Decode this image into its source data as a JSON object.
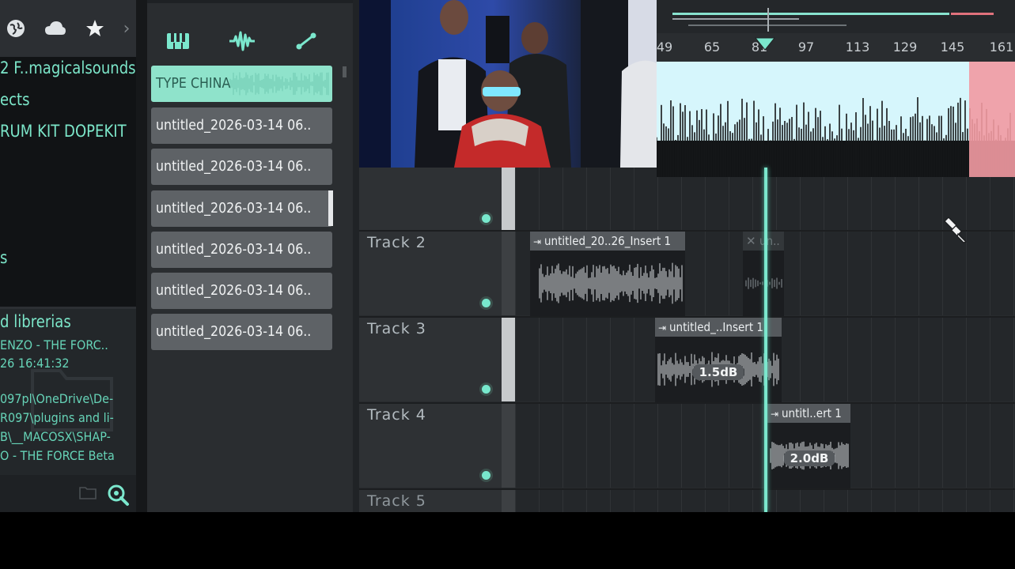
{
  "browser": {
    "icons": [
      {
        "name": "globe-icon",
        "glyph": "🌐"
      },
      {
        "name": "cloud-icon",
        "glyph": "☁"
      },
      {
        "name": "star-icon",
        "glyph": "★"
      },
      {
        "name": "chevron-right-icon",
        "glyph": "›"
      }
    ],
    "items": [
      "2 F..magicalsounds",
      "ects",
      "RUM KIT DOPEKIT",
      "s"
    ],
    "info": {
      "title": "d librerias",
      "lines": [
        "ENZO - THE FORC..",
        "26 16:41:32",
        "097pl\\OneDrive\\De-",
        "R097\\plugins and li-",
        "B\\__MACOSX\\SHAP-",
        "O - THE FORCE Beta"
      ]
    }
  },
  "picker": {
    "tabs": [
      "piano-keys-icon",
      "audio-wave-icon",
      "automation-curve-icon"
    ],
    "items": [
      {
        "label": "TYPE CHINA",
        "selected": true
      },
      {
        "label": "untitled_2026-03-14 06..",
        "selected": false
      },
      {
        "label": "untitled_2026-03-14 06..",
        "selected": false
      },
      {
        "label": "untitled_2026-03-14 06..",
        "selected": false
      },
      {
        "label": "untitled_2026-03-14 06..",
        "selected": false
      },
      {
        "label": "untitled_2026-03-14 06..",
        "selected": false
      },
      {
        "label": "untitled_2026-03-14 06..",
        "selected": false
      }
    ]
  },
  "ruler": {
    "numbers": [
      "49",
      "65",
      "81",
      "97",
      "113",
      "129",
      "145",
      "161"
    ]
  },
  "tracks": [
    {
      "name": "Track 2"
    },
    {
      "name": "Track 3"
    },
    {
      "name": "Track 4"
    },
    {
      "name": "Track 5"
    }
  ],
  "clips": {
    "t2a": {
      "label": "untitled_20..26_Insert 1"
    },
    "t2b": {
      "label": "un.."
    },
    "t3": {
      "label": "untitled_..Insert 1",
      "gain": "1.5dB"
    },
    "t4": {
      "label": "untitl..ert 1",
      "gain": "2.0dB"
    }
  },
  "colors": {
    "accent": "#7be7cd",
    "clip_header": "#55595d",
    "selected_pattern": "#8fe3cb",
    "loop_end": "#f08a92"
  }
}
